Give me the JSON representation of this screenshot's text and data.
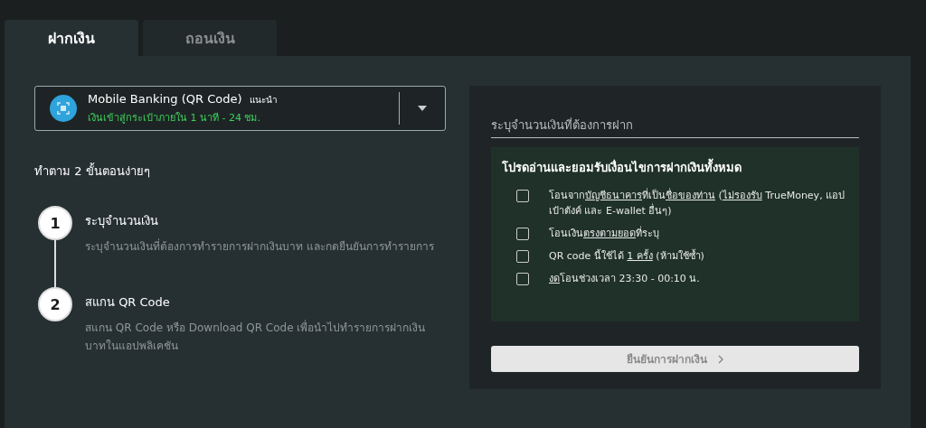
{
  "tabs": [
    {
      "label": "ฝากเงิน",
      "selected": true
    },
    {
      "label": "ถอนเงิน",
      "selected": false
    }
  ],
  "method": {
    "name": "Mobile Banking (QR Code)",
    "badge": "แนะนำ",
    "note": "เงินเข้าสู่กระเป๋าภายใน 1 นาที - 24 ชม."
  },
  "steps_title": "ทำตาม 2 ขั้นตอนง่ายๆ",
  "steps": [
    {
      "number": "1",
      "title": "ระบุจำนวนเงิน",
      "text": "ระบุจำนวนเงินที่ต้องการทำรายการฝากเงินบาท และกดยืนยันการทำรายการ"
    },
    {
      "number": "2",
      "title": "สแกน QR Code",
      "text": "สแกน QR Code หรือ Download QR Code เพื่อนำไปทำรายการฝากเงินบาทในแอปพลิเคชัน"
    }
  ],
  "amount": {
    "placeholder": "ระบุจำนวนเงินที่ต้องการฝาก"
  },
  "terms_title": "โปรดอ่านและยอมรับเงื่อนไขการฝากเงินทั้งหมด",
  "terms": [
    {
      "checked": false,
      "parts": [
        {
          "text": "โอนจาก",
          "underline": false
        },
        {
          "text": "บัญชีธนาคาร",
          "underline": true
        },
        {
          "text": "ที่เป็น",
          "underline": false
        },
        {
          "text": "ชื่อของท่าน",
          "underline": true
        },
        {
          "text": " (",
          "underline": false
        },
        {
          "text": "ไม่รองรับ",
          "underline": true
        },
        {
          "text": " TrueMoney, แอปเป๋าตังค์ และ E-wallet อื่นๆ)",
          "underline": false
        }
      ]
    },
    {
      "checked": false,
      "parts": [
        {
          "text": "โอนเงิน",
          "underline": false
        },
        {
          "text": "ตรงตามยอด",
          "underline": true
        },
        {
          "text": "ที่ระบุ",
          "underline": false
        }
      ]
    },
    {
      "checked": false,
      "parts": [
        {
          "text": "QR code นี้ใช้ได้ ",
          "underline": false
        },
        {
          "text": "1 ครั้ง",
          "underline": true
        },
        {
          "text": " (ห้ามใช้ซ้ำ)",
          "underline": false
        }
      ]
    },
    {
      "checked": false,
      "parts": [
        {
          "text": "งด",
          "underline": true
        },
        {
          "text": "โอนช่วงเวลา 23:30 - 00:10 น.",
          "underline": false
        }
      ]
    }
  ],
  "confirm": {
    "label": "ยืนยันการฝากเงิน",
    "disabled": true
  }
}
